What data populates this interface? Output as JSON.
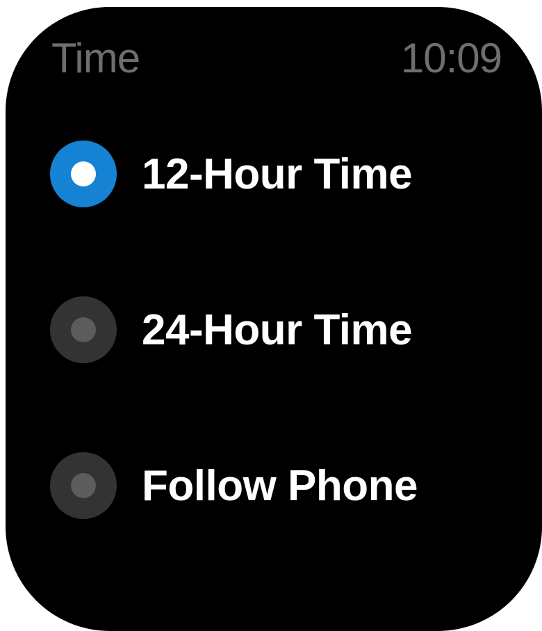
{
  "header": {
    "title": "Time",
    "clock": "10:09"
  },
  "options": [
    {
      "label": "12-Hour Time",
      "selected": true
    },
    {
      "label": "24-Hour Time",
      "selected": false
    },
    {
      "label": "Follow Phone",
      "selected": false
    }
  ],
  "colors": {
    "background": "#000000",
    "accent": "#1582d4",
    "radio_unselected": "#333333",
    "header_text": "#6e6e6e",
    "label_text": "#ffffff"
  },
  "icons": {
    "selected": "radio-selected-icon",
    "unselected": "radio-unselected-icon"
  }
}
